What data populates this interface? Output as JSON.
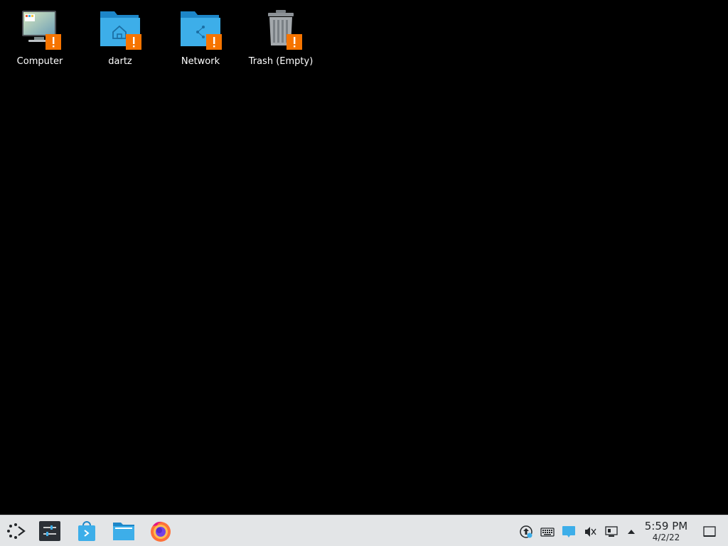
{
  "desktop": {
    "icons": [
      {
        "label": "Computer",
        "icon": "computer-icon"
      },
      {
        "label": "dartz",
        "icon": "home-folder-icon"
      },
      {
        "label": "Network",
        "icon": "network-folder-icon"
      },
      {
        "label": "Trash (Empty)",
        "icon": "trash-icon"
      }
    ]
  },
  "taskbar": {
    "launchers": [
      {
        "icon": "application-launcher-icon"
      },
      {
        "icon": "system-settings-icon"
      },
      {
        "icon": "discover-store-icon"
      },
      {
        "icon": "dolphin-file-manager-icon"
      },
      {
        "icon": "firefox-icon"
      }
    ],
    "tray": [
      {
        "icon": "updates-icon"
      },
      {
        "icon": "keyboard-icon"
      },
      {
        "icon": "notifications-icon"
      },
      {
        "icon": "volume-muted-icon"
      },
      {
        "icon": "network-wired-icon"
      },
      {
        "icon": "tray-expand-arrow-icon"
      }
    ],
    "clock": {
      "time": "5:59 PM",
      "date": "4/2/22"
    },
    "show_desktop": {
      "icon": "show-desktop-icon"
    }
  },
  "colors": {
    "desktop_background": "#000000",
    "panel_background": "#e3e5e7",
    "folder_blue": "#3daee9",
    "warning_badge": "#f67400"
  }
}
